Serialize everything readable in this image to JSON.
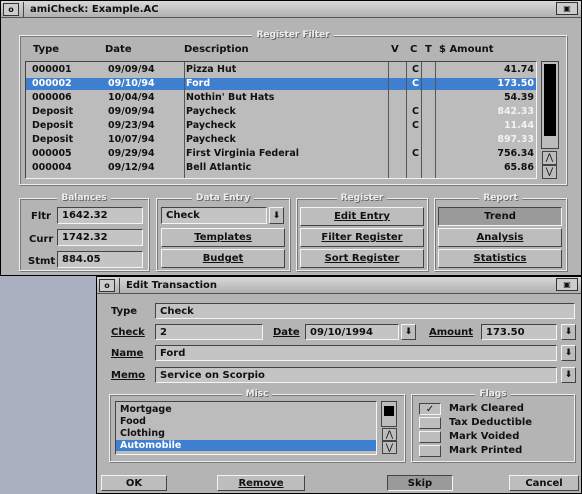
{
  "main_window": {
    "title": "amiCheck: Example.AC",
    "close_glyph": "o",
    "depth_glyph": "▣"
  },
  "register_filter": {
    "label": "Register Filter",
    "columns": [
      "Type",
      "Date",
      "Description",
      "V",
      "C",
      "T",
      "$ Amount"
    ],
    "rows": [
      {
        "type": "000001",
        "date": "09/09/94",
        "desc": "Pizza Hut",
        "v": "",
        "c": "C",
        "t": "",
        "amount": "41.74",
        "hi": false
      },
      {
        "type": "000002",
        "date": "09/10/94",
        "desc": "Ford",
        "v": "",
        "c": "C",
        "t": "",
        "amount": "173.50",
        "hi": false
      },
      {
        "type": "000006",
        "date": "10/04/94",
        "desc": "Nothin' But Hats",
        "v": "",
        "c": "",
        "t": "",
        "amount": "54.39",
        "hi": false
      },
      {
        "type": "Deposit",
        "date": "09/09/94",
        "desc": "Paycheck",
        "v": "",
        "c": "C",
        "t": "",
        "amount": "842.33",
        "hi": true
      },
      {
        "type": "Deposit",
        "date": "09/23/94",
        "desc": "Paycheck",
        "v": "",
        "c": "C",
        "t": "",
        "amount": "11.44",
        "hi": true
      },
      {
        "type": "Deposit",
        "date": "10/07/94",
        "desc": "Paycheck",
        "v": "",
        "c": "",
        "t": "",
        "amount": "897.33",
        "hi": true
      },
      {
        "type": "000005",
        "date": "09/29/94",
        "desc": "First Virginia Federal",
        "v": "",
        "c": "C",
        "t": "",
        "amount": "756.34",
        "hi": false
      },
      {
        "type": "000004",
        "date": "09/12/94",
        "desc": "Bell Atlantic",
        "v": "",
        "c": "",
        "t": "",
        "amount": "65.86",
        "hi": false
      }
    ],
    "selected_index": 1
  },
  "balances": {
    "label": "Balances",
    "fltr_label": "Fltr",
    "fltr_value": "1642.32",
    "curr_label": "Curr",
    "curr_value": "1742.32",
    "stmt_label": "Stmt",
    "stmt_value": "884.05"
  },
  "data_entry": {
    "label": "Data Entry",
    "type_value": "Check",
    "templates_label": "Templates",
    "budget_label": "Budget"
  },
  "register": {
    "label": "Register",
    "edit_entry": "Edit Entry",
    "filter_register": "Filter Register",
    "sort_register": "Sort Register"
  },
  "report": {
    "label": "Report",
    "trend": "Trend",
    "analysis": "Analysis",
    "statistics": "Statistics"
  },
  "edit_window": {
    "title": "Edit Transaction",
    "type_label": "Type",
    "type_value": "Check",
    "check_label": "Check",
    "check_value": "2",
    "date_label": "Date",
    "date_value": "09/10/1994",
    "amount_label": "Amount",
    "amount_value": "173.50",
    "name_label": "Name",
    "name_value": "Ford",
    "memo_label": "Memo",
    "memo_value": "Service on Scorpio",
    "misc_label": "Misc",
    "misc_items": [
      "Mortgage",
      "Food",
      "Clothing",
      "Automobile"
    ],
    "misc_selected": 3,
    "flags_label": "Flags",
    "flags": [
      {
        "label": "Mark Cleared",
        "checked": true
      },
      {
        "label": "Tax Deductible",
        "checked": false
      },
      {
        "label": "Mark Voided",
        "checked": false
      },
      {
        "label": "Mark Printed",
        "checked": false
      }
    ],
    "ok_label": "OK",
    "remove_label": "Remove",
    "skip_label": "Skip",
    "cancel_label": "Cancel"
  },
  "icons": {
    "dropdown": "⬇",
    "check_mark": "✓",
    "up_arrow": "⋀",
    "down_arrow": "⋁"
  },
  "colors": {
    "selection": "#3f7fd0",
    "window_bg": "#b4b4b4"
  }
}
